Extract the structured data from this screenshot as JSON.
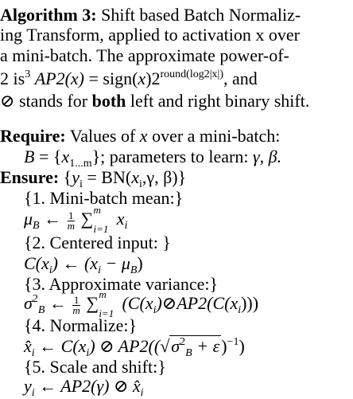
{
  "algorithm": {
    "title_label": "Algorithm 3:",
    "caption": {
      "line1": "Shift based Batch Normaliz-",
      "line2": "ing Transform, applied to activation x over",
      "line3a": "a mini-batch.  The approximate power-of-",
      "line4_lead": "2 is",
      "line4_sup": "3",
      "line4_ap2": "AP2",
      "line4_x": "(x)",
      "line4_eq": "= sign(",
      "line4_x2": "x",
      "line4_close": ")2",
      "line4_exp": "round(log2|x|)",
      "line4_tail": ", and",
      "line5_sym": "⊘",
      "line5_pre": "stands for",
      "line5_bold": "both",
      "line5_post": "left and right binary shift."
    },
    "require_label": "Require:",
    "require_line1": "Values of",
    "require_x": "x",
    "require_line1_tail": "over a mini-batch:",
    "require_line2_B": "B",
    "require_line2_set": "= {",
    "require_line2_x": "x",
    "require_line2_sub": "1...m",
    "require_line2_tail": "}; parameters to learn:",
    "require_gamma": "γ, β.",
    "ensure_label": "Ensure:",
    "ensure_body_a": "{",
    "ensure_y": "y",
    "ensure_sub_i": "i",
    "ensure_eq": "= BN(",
    "ensure_args": "x",
    "ensure_args2": ",γ, β)}",
    "steps": [
      "{1. Mini-batch mean:}",
      "{2. Centered input: }",
      "{3. Approximate variance:}",
      "{4. Normalize:}",
      "{5. Scale and shift:}"
    ],
    "eq1_lhs": "μ",
    "eq1_sub": "B",
    "eq1_arrow": "←",
    "frac_num": "1",
    "frac_den": "m",
    "sum_up": "m",
    "sum_lo": "i=1",
    "eq1_rhs": "x",
    "eq1_rhs_sub": "i",
    "eq2_lhs": "C(x",
    "eq2_sub": "i",
    "eq2_mid": ") ← (x",
    "eq2_sub2": "i",
    "eq2_tail": "− μ",
    "eq2_tail_sub": "B",
    "eq2_close": ")",
    "eq3_lhs": "σ",
    "eq3_sup": "2",
    "eq3_sub": "B",
    "eq3_rhs": "(C(x",
    "eq3_rhs_sub": "i",
    "eq3_rhs2": ")⊘AP2(C(x",
    "eq3_rhs_sub2": "i",
    "eq3_rhs3": ")))",
    "eq4_lhs": "x̂",
    "eq4_sub": "i",
    "eq4_mid": "← C(x",
    "eq4_sub2": "i",
    "eq4_rhs": ") ⊘ AP2((",
    "eq4_sqrt_pre": "√",
    "eq4_sqrt": "σ",
    "eq4_sqrt_sup": "2",
    "eq4_sqrt_sub": "B",
    "eq4_sqrt_tail": " + ε",
    "eq4_close": ")",
    "eq4_exp": "−1",
    "eq4_end": ")",
    "eq5_lhs": "y",
    "eq5_sub": "i",
    "eq5_rhs": "← AP2(γ) ⊘ x̂",
    "eq5_rhs_sub": "i"
  }
}
